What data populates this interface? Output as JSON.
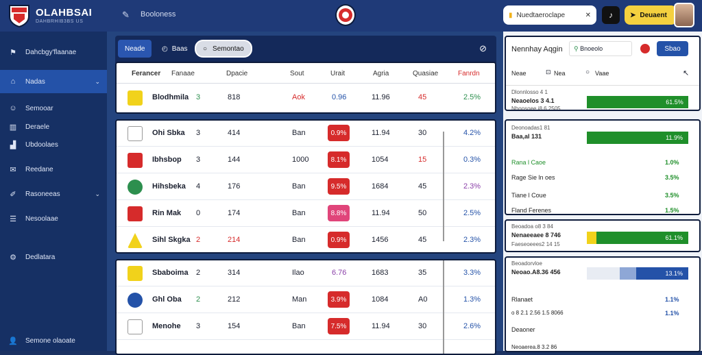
{
  "brand": {
    "title": "OLAHBSAI",
    "subtitle": "DAHBRHIB3BS US"
  },
  "top": {
    "link": "Booloness",
    "search": "Nuedtaeroclape",
    " cta": "",
    "cta_label": "Deuaent"
  },
  "sidebar": {
    "items": [
      {
        "label": "Dahcbgy'flaanae",
        "icon": "flag-icon"
      },
      {
        "label": "Nadas",
        "icon": "home-icon",
        "active": true
      },
      {
        "label": "Semooar",
        "icon": "people-icon"
      },
      {
        "label": "Deraele",
        "icon": "bar-icon"
      },
      {
        "label": "Ubdoolaes",
        "icon": "chart-icon"
      },
      {
        "label": "Reedane",
        "icon": "mail-icon"
      },
      {
        "label": "Rasoneeas",
        "icon": "pen-icon"
      },
      {
        "label": "Nesoolaae",
        "icon": "list-icon"
      },
      {
        "label": "Dedlatara",
        "icon": "settings-icon"
      },
      {
        "label": "Semone olaoate",
        "icon": "user-icon"
      }
    ]
  },
  "toolbar": {
    "btn_a": "Neade",
    "btn_b": "Baas",
    "btn_c": "Semontao"
  },
  "table": {
    "headers": [
      "Ferancer",
      "Fanaae",
      "Dpacie",
      "Sout",
      "Urait",
      "Agria",
      "Quasiae",
      "Fanrdn"
    ],
    "rows": [
      {
        "name": "Blodhmila",
        "num": "3",
        "c1": "818",
        "c2": "Aok",
        "c3": "0.96",
        "c4": "11.96",
        "c5": "45",
        "c6": "2.5%",
        "logo": "#f1d21b"
      },
      {
        "name": "Ohi Sbka",
        "num": "3",
        "c1": "414",
        "c2": "Ban",
        "c3": "0.9%",
        "c4": "11.94",
        "c5": "30",
        "c6": "4.2%",
        "logo": "#ffffff"
      },
      {
        "name": "Ibhsbop",
        "num": "3",
        "c1": "144",
        "c2": "1000",
        "c3": "8.1%",
        "c4": "1054",
        "c5": "15",
        "c6": "0.3%",
        "logo": "#d62b2b"
      },
      {
        "name": "Hihsbeka",
        "num": "4",
        "c1": "176",
        "c2": "Ban",
        "c3": "9.5%",
        "c4": "1684",
        "c5": "45",
        "c6": "2.3%",
        "logo": "#2d8f4e"
      },
      {
        "name": "Rin Mak",
        "num": "0",
        "c1": "174",
        "c2": "Ban",
        "c3": "8.8%",
        "c4": "11.94",
        "c5": "50",
        "c6": "2.5%",
        "logo": "#d62b2b"
      },
      {
        "name": "Sihl Skgka",
        "num": "2",
        "c1": "214",
        "c2": "Ban",
        "c3": "0.9%",
        "c4": "1456",
        "c5": "45",
        "c6": "2.3%",
        "logo": "#f1d21b"
      },
      {
        "name": "Sbaboima",
        "num": "2",
        "c1": "314",
        "c2": "Ilao",
        "c3": "6.76",
        "c4": "1683",
        "c5": "35",
        "c6": "3.3%",
        "logo": "#f1d21b"
      },
      {
        "name": "Ghl Oba",
        "num": "2",
        "c1": "212",
        "c2": "Man",
        "c3": "3.9%",
        "c4": "1084",
        "c5": "A0",
        "c6": "1.3%",
        "logo": "#2452a8"
      },
      {
        "name": "Menohe",
        "num": "3",
        "c1": "154",
        "c2": "Ban",
        "c3": "7.5%",
        "c4": "11.94",
        "c5": "30",
        "c6": "2.6%",
        "logo": "#ffffff"
      }
    ]
  },
  "right": {
    "header": "Nennhay Aqgin",
    "search": "Bnoeolo",
    "btn": "Sbao",
    "tabs": [
      "Neae",
      "Nea",
      "Vaae"
    ],
    "cards": [
      {
        "small": "Dlonnlosso 4 1",
        "title": "Neaoelos 3 4.1",
        "sub": "Nboosoee i8 6 2505",
        "pct": "61.5%"
      },
      {
        "small": "Deonoadas1 81",
        "title": "Baa,al 131",
        "pct": "11.9%",
        "items": [
          {
            "label": "Rana l Caoe",
            "pct": "1.0%"
          },
          {
            "label": "Rage Sie ln oes",
            "pct": "3.5%"
          },
          {
            "label": "Tiane l Coue",
            "pct": "3.5%"
          },
          {
            "label": "Fland Ferenes",
            "pct": "1.5%"
          }
        ]
      },
      {
        "small": "Beoadoa o8 3 84",
        "title": "Nenaeeaee 8 746",
        "sub": "Faeseoeees2 14 15",
        "pct": "61.1%"
      },
      {
        "small": "Beoadorvloe",
        "title": "Neoao.A8.36 456",
        "pct": "13.1%",
        "items": [
          {
            "label": "Rlanaet",
            "pct": "1.1%"
          },
          {
            "label": "o 8 2.1 2.56 1.5 8066",
            "pct": "1.1%"
          },
          {
            "label": "Deaoner",
            "pct": ""
          },
          {
            "label": "Neoaerea.8 3.2 86",
            "pct": ""
          }
        ]
      }
    ]
  }
}
